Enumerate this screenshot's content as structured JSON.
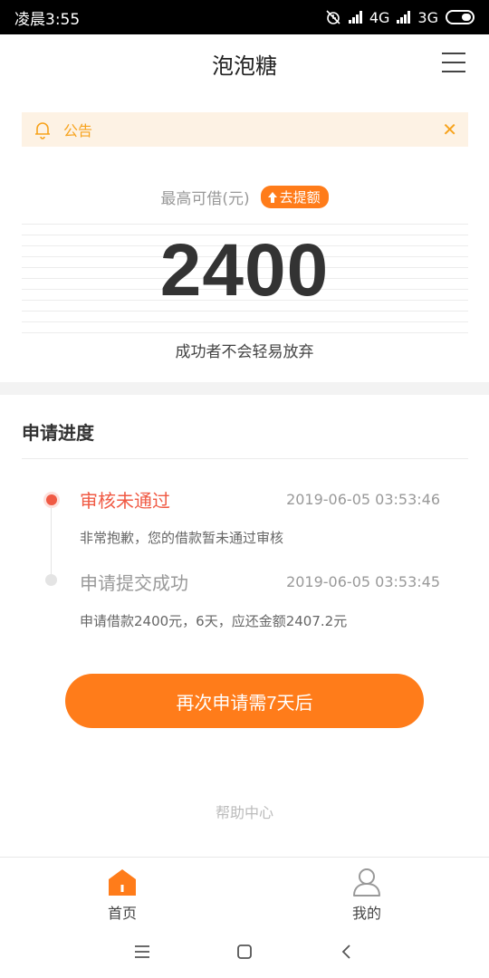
{
  "status_bar": {
    "time": "凌晨3:55",
    "network1": "4G",
    "network2": "3G"
  },
  "app": {
    "title": "泡泡糖"
  },
  "notice": {
    "label": "公告"
  },
  "credit": {
    "limit_label": "最高可借(元)",
    "raise_label": "去提额",
    "amount": "2400",
    "slogan": "成功者不会轻易放弃"
  },
  "progress": {
    "title": "申请进度",
    "steps": [
      {
        "title": "审核未通过",
        "time": "2019-06-05 03:53:46",
        "desc": "非常抱歉，您的借款暂未通过审核"
      },
      {
        "title": "申请提交成功",
        "time": "2019-06-05 03:53:45",
        "desc": "申请借款2400元，6天，应还金额2407.2元"
      }
    ],
    "retry_label": "再次申请需7天后",
    "help_label": "帮助中心"
  },
  "tabs": [
    {
      "label": "首页",
      "icon": "home-icon",
      "active": true
    },
    {
      "label": "我的",
      "icon": "profile-icon",
      "active": false
    }
  ],
  "colors": {
    "accent": "#ff7c1a",
    "error": "#f05a44",
    "notice_bg": "#fdf2e4",
    "notice_text": "#f7a31d"
  }
}
